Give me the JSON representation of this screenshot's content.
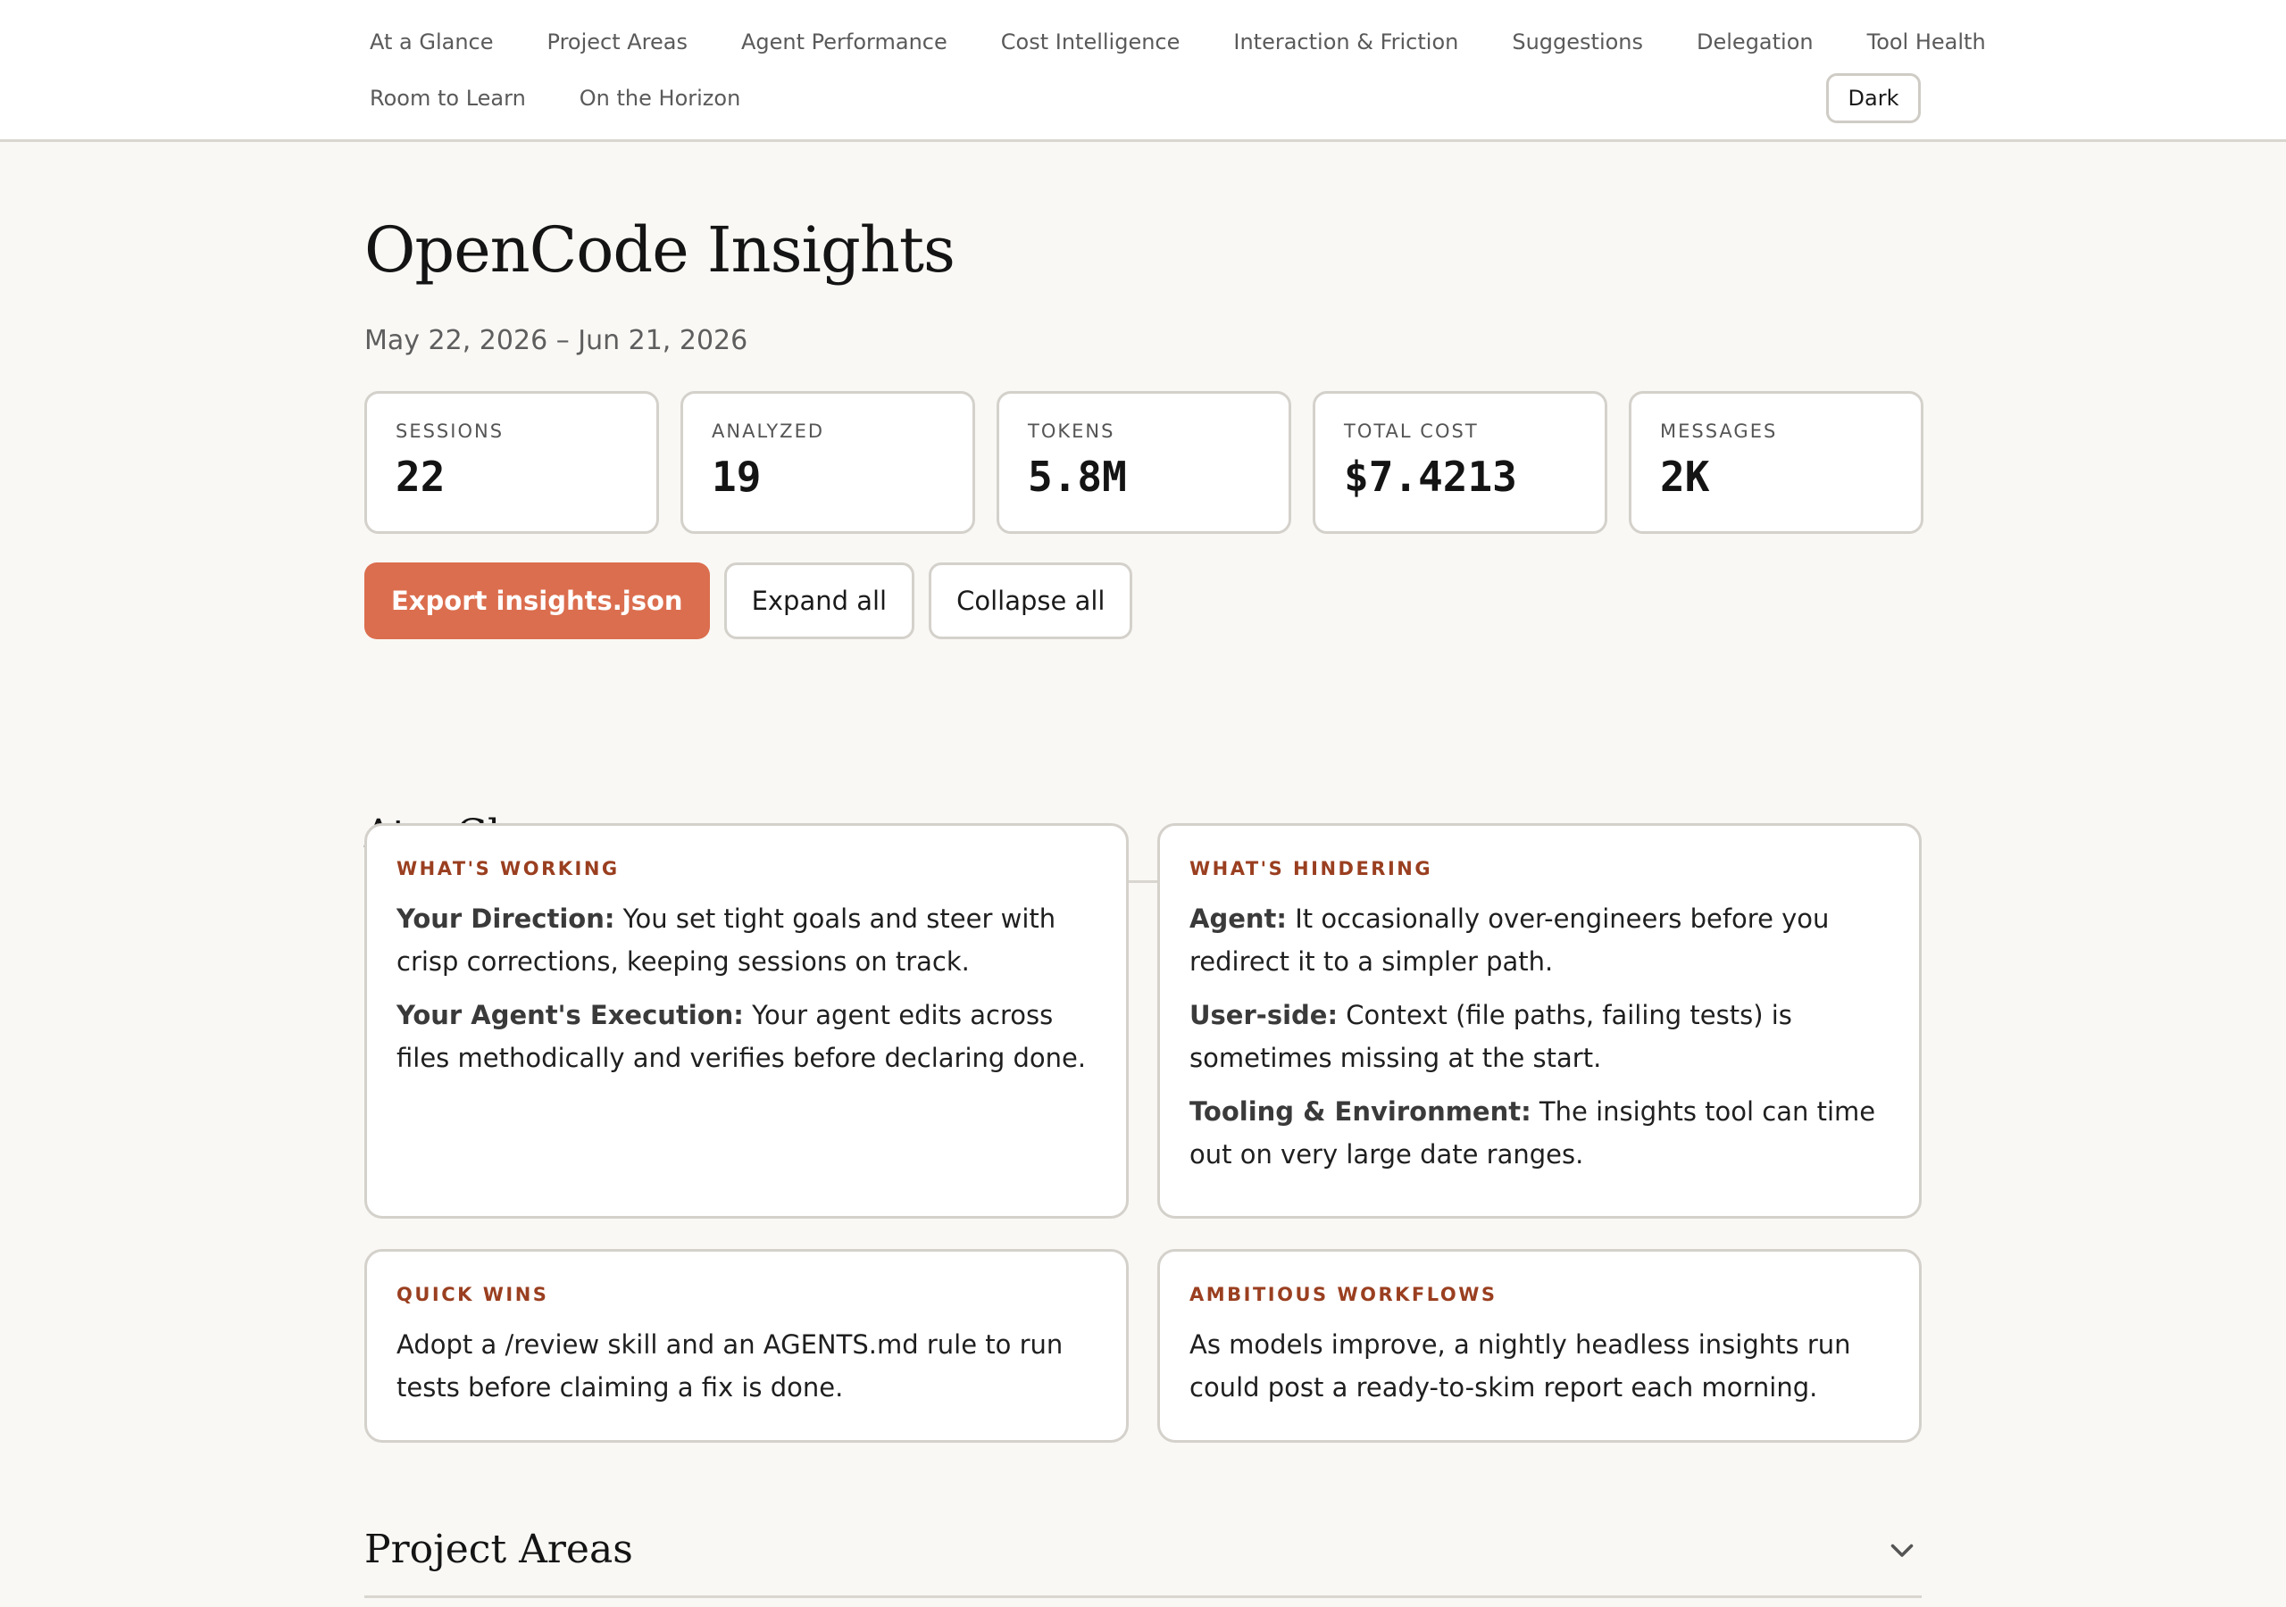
{
  "nav": {
    "row1": [
      "At a Glance",
      "Project Areas",
      "Agent Performance",
      "Cost Intelligence",
      "Interaction & Friction",
      "Suggestions",
      "Delegation",
      "Tool Health"
    ],
    "row2": [
      "Room to Learn",
      "On the Horizon"
    ],
    "theme_toggle": "Dark"
  },
  "header": {
    "title": "OpenCode Insights",
    "date_range": "May 22, 2026 – Jun 21, 2026"
  },
  "stats": [
    {
      "label": "SESSIONS",
      "value": "22"
    },
    {
      "label": "ANALYZED",
      "value": "19"
    },
    {
      "label": "TOKENS",
      "value": "5.8M"
    },
    {
      "label": "TOTAL COST",
      "value": "$7.4213"
    },
    {
      "label": "MESSAGES",
      "value": "2K"
    }
  ],
  "actions": {
    "export": "Export insights.json",
    "expand": "Expand all",
    "collapse": "Collapse all"
  },
  "sections": {
    "glance": {
      "title": "At a Glance",
      "working": {
        "label": "WHAT'S WORKING",
        "items": [
          {
            "lead": "Your Direction:",
            "text": " You set tight goals and steer with crisp corrections, keeping sessions on track."
          },
          {
            "lead": "Your Agent's Execution:",
            "text": " Your agent edits across files methodically and verifies before declaring done."
          }
        ]
      },
      "hindering": {
        "label": "WHAT'S HINDERING",
        "items": [
          {
            "lead": "Agent:",
            "text": " It occasionally over-engineers before you redirect it to a simpler path."
          },
          {
            "lead": "User-side:",
            "text": " Context (file paths, failing tests) is sometimes missing at the start."
          },
          {
            "lead": "Tooling & Environment:",
            "text": " The insights tool can time out on very large date ranges."
          }
        ]
      },
      "quick_wins": {
        "label": "QUICK WINS",
        "text": "Adopt a /review skill and an AGENTS.md rule to run tests before claiming a fix is done."
      },
      "ambitious": {
        "label": "AMBITIOUS WORKFLOWS",
        "text": "As models improve, a nightly headless insights run could post a ready-to-skim report each morning."
      }
    },
    "project_areas": {
      "title": "Project Areas"
    }
  },
  "colors": {
    "accent": "#db6e4e",
    "card_label": "#9a3f20",
    "background": "#f9f8f5"
  }
}
